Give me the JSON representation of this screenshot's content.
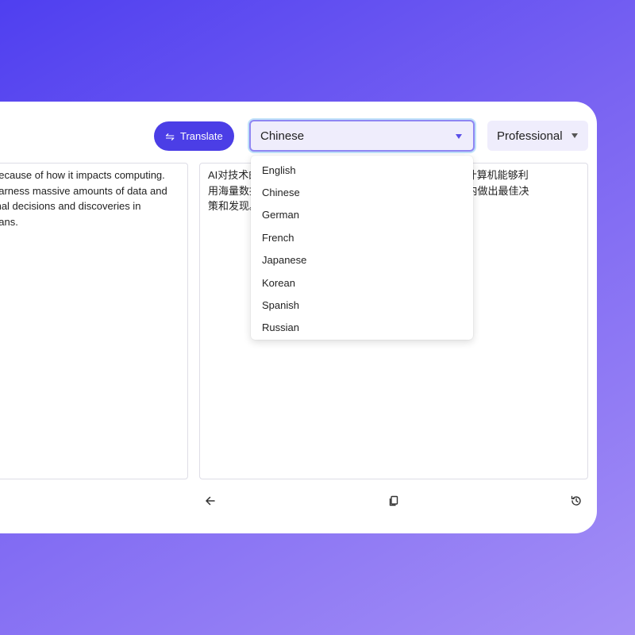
{
  "toolbar": {
    "translate_label": "Translate",
    "translate_icon": "swap-arrows-icon",
    "language_selected": "Chinese",
    "tone_selected": "Professional"
  },
  "source": {
    "lines": [
      "because of how it impacts computing.",
      "harness massive amounts of data and",
      "mal decisions and discoveries in",
      "nans."
    ]
  },
  "output": {
    "lines": [
      "AI对技术的                                                          工智能，计算机能够利",
      "用海量数据                                                          部分时间内做出最佳决",
      "策和发现。"
    ]
  },
  "language_dropdown": {
    "options": [
      "English",
      "Chinese",
      "German",
      "French",
      "Japanese",
      "Korean",
      "Spanish",
      "Russian"
    ]
  },
  "footer": {
    "icons": [
      "back-arrow-icon",
      "copy-icon",
      "history-icon"
    ]
  },
  "colors": {
    "accent": "#4b3ee6",
    "select_bg": "#efedfc",
    "background_start": "#4f3ff0",
    "background_end": "#a48ff6"
  }
}
